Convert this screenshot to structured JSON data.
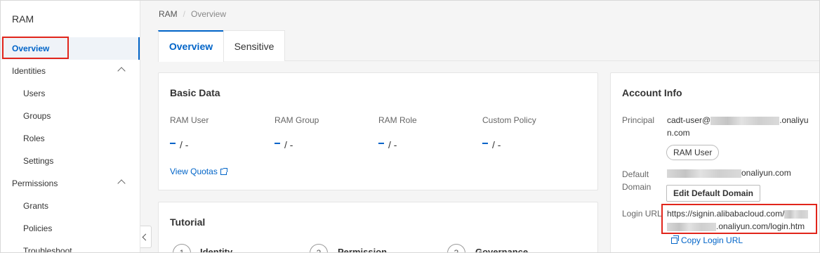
{
  "sidebar": {
    "title": "RAM",
    "items": [
      {
        "label": "Overview"
      },
      {
        "label": "Identities"
      },
      {
        "label": "Users"
      },
      {
        "label": "Groups"
      },
      {
        "label": "Roles"
      },
      {
        "label": "Settings"
      },
      {
        "label": "Permissions"
      },
      {
        "label": "Grants"
      },
      {
        "label": "Policies"
      },
      {
        "label": "Troubleshoot"
      }
    ]
  },
  "breadcrumb": {
    "root": "RAM",
    "separator": "/",
    "current": "Overview"
  },
  "tabs": [
    {
      "label": "Overview"
    },
    {
      "label": "Sensitive"
    }
  ],
  "basic_data": {
    "title": "Basic Data",
    "stats": [
      {
        "label": "RAM User",
        "suffix": "/ -"
      },
      {
        "label": "RAM Group",
        "suffix": "/ -"
      },
      {
        "label": "RAM Role",
        "suffix": "/ -"
      },
      {
        "label": "Custom Policy",
        "suffix": "/ -"
      }
    ],
    "view_quotas": "View Quotas"
  },
  "tutorial": {
    "title": "Tutorial",
    "steps": [
      {
        "num": "1",
        "label": "Identity"
      },
      {
        "num": "2",
        "label": "Permission"
      },
      {
        "num": "3",
        "label": "Governance"
      }
    ]
  },
  "account_info": {
    "title": "Account Info",
    "principal_label": "Principal",
    "principal_prefix": "cadt-user@",
    "principal_suffix_a": ".onaliyu",
    "principal_suffix_b": "n.com",
    "principal_tag": "RAM User",
    "default_domain_label_a": "Default",
    "default_domain_label_b": "Domain",
    "default_domain_suffix": "onaliyun.com",
    "edit_button": "Edit Default Domain",
    "login_url_label": "Login URL",
    "login_url_a": "https://signin.alibabacloud.com/",
    "login_url_b": ".onaliyun.com/login.htm",
    "copy_label": "Copy Login URL"
  },
  "colors": {
    "accent": "#0064c8",
    "highlight": "#e1251b"
  }
}
